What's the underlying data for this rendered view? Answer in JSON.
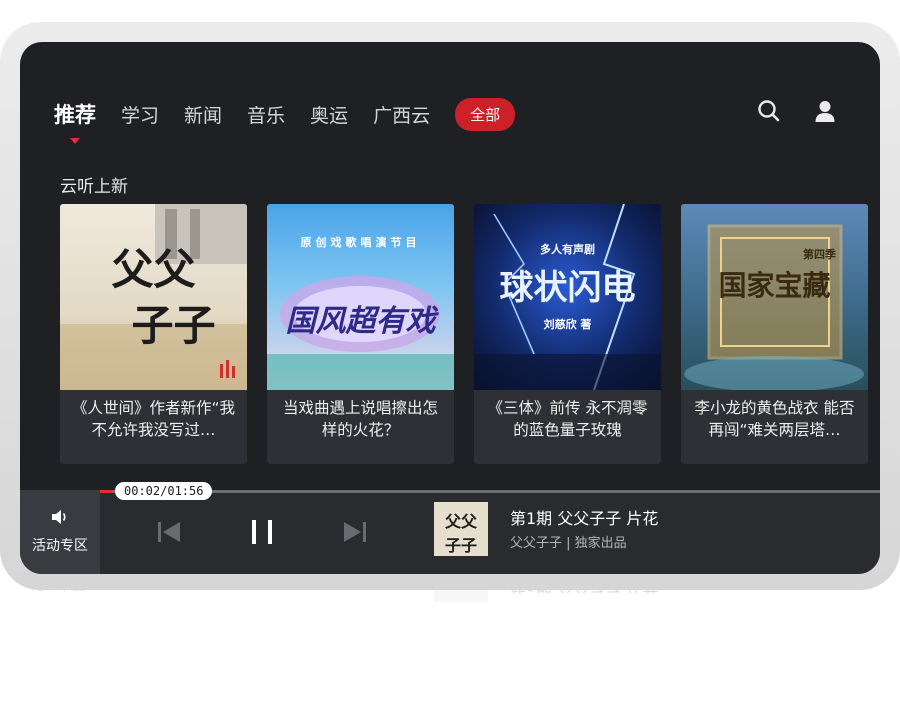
{
  "nav": {
    "tabs": [
      {
        "label": "推荐",
        "active": true
      },
      {
        "label": "学习"
      },
      {
        "label": "新闻"
      },
      {
        "label": "音乐"
      },
      {
        "label": "奥运"
      },
      {
        "label": "广西云"
      }
    ],
    "all_button": "全部",
    "icons": [
      "search-icon",
      "user-icon"
    ]
  },
  "section": {
    "title": "云听上新"
  },
  "cards": [
    {
      "title": "《人世间》作者新作“我不允许我没写过…",
      "cover_text": [
        "父父",
        "子子"
      ]
    },
    {
      "title": "当戏曲遇上说唱擦出怎样的火花？",
      "cover_text": [
        "原创戏歌唱演节目",
        "国风超有戏"
      ]
    },
    {
      "title": "《三体》前传 永不凋零的蓝色量子玫瑰",
      "cover_text": [
        "多人有声剧",
        "球状闪电",
        "刘慈欣 著"
      ]
    },
    {
      "title": "李小龙的黄色战衣 能否再闯“难关两层塔…",
      "cover_text": [
        "国家宝藏",
        "第四季"
      ]
    }
  ],
  "player": {
    "activity_label": "活动专区",
    "time": "00:02/01:56",
    "progress": 0.017,
    "track_title": "第1期  父父子子 片花",
    "track_sub": "父父子子 | 独家出品",
    "thumb_text": [
      "父父",
      "子子"
    ]
  },
  "colors": {
    "accent": "#cc2129",
    "background": "#1f2024",
    "card": "#2e3035"
  }
}
